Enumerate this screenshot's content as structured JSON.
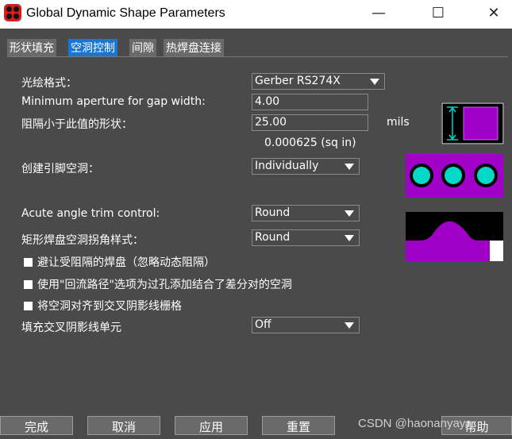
{
  "window": {
    "title": "Global Dynamic Shape Parameters"
  },
  "tabs": [
    {
      "label": "形状填充"
    },
    {
      "label": "空洞控制"
    },
    {
      "label": "间隙"
    },
    {
      "label": "热焊盘连接"
    }
  ],
  "form": {
    "artwork_format_label": "光绘格式：",
    "artwork_format_value": "Gerber RS274X",
    "min_aperture_label": "Minimum aperture for gap width:",
    "min_aperture_value": "4.00",
    "small_shape_label": "阻隔小于此值的形状：",
    "small_shape_value": "25.00",
    "unit_label": "mils",
    "area_text": "0.000625 (sq in)",
    "create_pin_voids_label": "创建引脚空洞：",
    "create_pin_voids_value": "Individually",
    "acute_angle_label": "Acute angle trim control:",
    "acute_angle_value": "Round",
    "rect_corner_label": "矩形焊盘空洞拐角样式：",
    "rect_corner_value": "Round",
    "checkbox_1": "避让受阻隔的焊盘（忽略动态阻隔）",
    "checkbox_2": "使用\"回流路径\"选项为过孔添加结合了差分对的空洞",
    "checkbox_3": "将空洞对齐到交叉阴影线栅格",
    "fill_cell_label": "填充交叉阴影线单元",
    "fill_cell_value": "Off"
  },
  "buttons": {
    "ok": "完成",
    "cancel": "取消",
    "apply": "应用",
    "reset": "重置",
    "help": "帮助"
  },
  "watermark": "CSDN @haonanyaya",
  "colors": {
    "accent": "#1976d2",
    "preview_fill": "#a000c8",
    "preview_teal": "#00d8c8"
  }
}
